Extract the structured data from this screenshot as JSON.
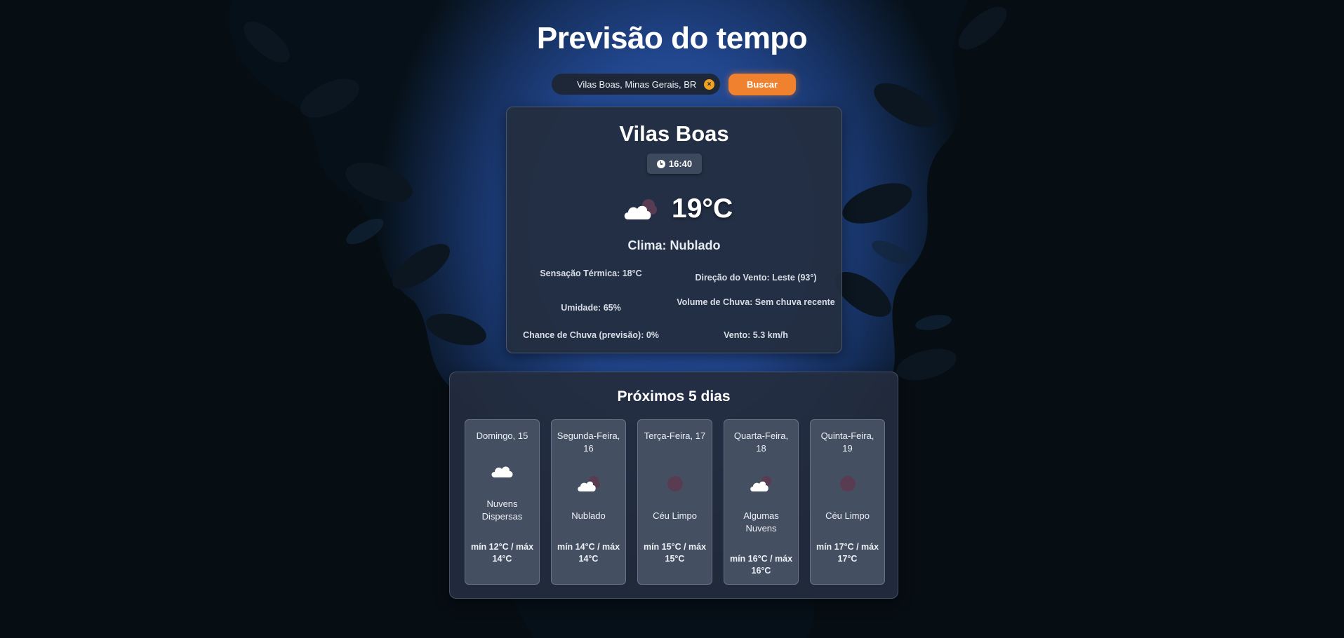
{
  "header": {
    "title": "Previsão do tempo"
  },
  "search": {
    "value": "Vilas Boas, Minas Gerais, BR",
    "clear_label": "×",
    "button_label": "Buscar"
  },
  "current": {
    "city": "Vilas Boas",
    "time": "16:40",
    "temperature": "19°C",
    "icon": "cloudy-icon",
    "description": "Clima: Nublado",
    "details": {
      "feels_like": "Sensação Térmica: 18°C",
      "wind_direction": "Direção do Vento: Leste (93°)",
      "humidity": "Umidade: 65%",
      "rain_volume": "Volume de Chuva: Sem chuva recente",
      "rain_chance": "Chance de Chuva (previsão): 0%",
      "wind": "Vento: 5.3 km/h"
    }
  },
  "forecast": {
    "title": "Próximos 5 dias",
    "days": [
      {
        "name": "Domingo, 15",
        "icon": "scattered-clouds-icon",
        "description": "Nuvens Dispersas",
        "temps": "mín 12°C / máx 14°C"
      },
      {
        "name": "Segunda-Feira, 16",
        "icon": "cloudy-icon",
        "description": "Nublado",
        "temps": "mín 14°C / máx 14°C"
      },
      {
        "name": "Terça-Feira, 17",
        "icon": "clear-night-icon",
        "description": "Céu Limpo",
        "temps": "mín 15°C / máx 15°C"
      },
      {
        "name": "Quarta-Feira, 18",
        "icon": "few-clouds-icon",
        "description": "Algumas Nuvens",
        "temps": "mín 16°C / máx 16°C"
      },
      {
        "name": "Quinta-Feira, 19",
        "icon": "clear-night-icon",
        "description": "Céu Limpo",
        "temps": "mín 17°C / máx 17°C"
      }
    ]
  },
  "colors": {
    "accent": "#f0822f",
    "card": "#242d3e",
    "sky": "#22478f"
  }
}
